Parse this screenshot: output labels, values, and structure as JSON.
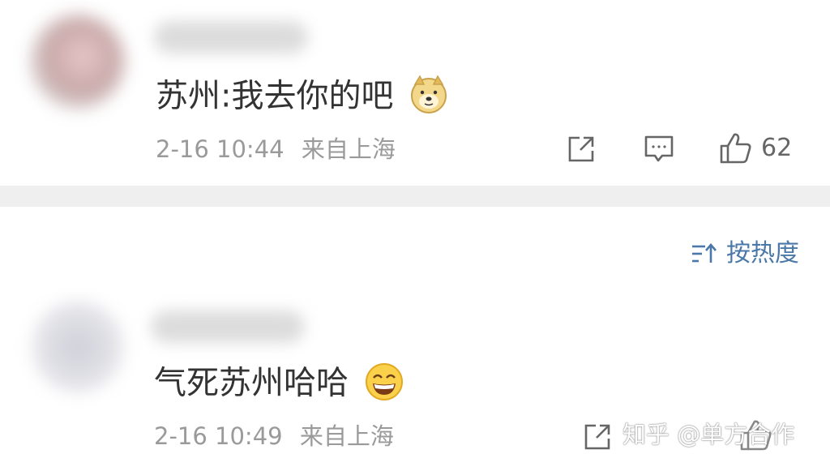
{
  "comments": [
    {
      "text": "苏州:我去你的吧",
      "emoji": "doge-emoji",
      "date": "2-16 10:44",
      "location": "来自上海",
      "likes": "62"
    },
    {
      "text": "气死苏州哈哈",
      "emoji": "grin-emoji",
      "date": "2-16 10:49",
      "location": "来自上海"
    }
  ],
  "sort": {
    "label": "按热度"
  },
  "watermark": {
    "text": "知乎 @单方合作"
  },
  "icons": [
    "share-icon",
    "reply-icon",
    "like-icon",
    "sort-icon"
  ],
  "colors": {
    "sort_text": "#4a78a8",
    "meta_text": "#9a9a9a",
    "divider": "#efefef"
  }
}
